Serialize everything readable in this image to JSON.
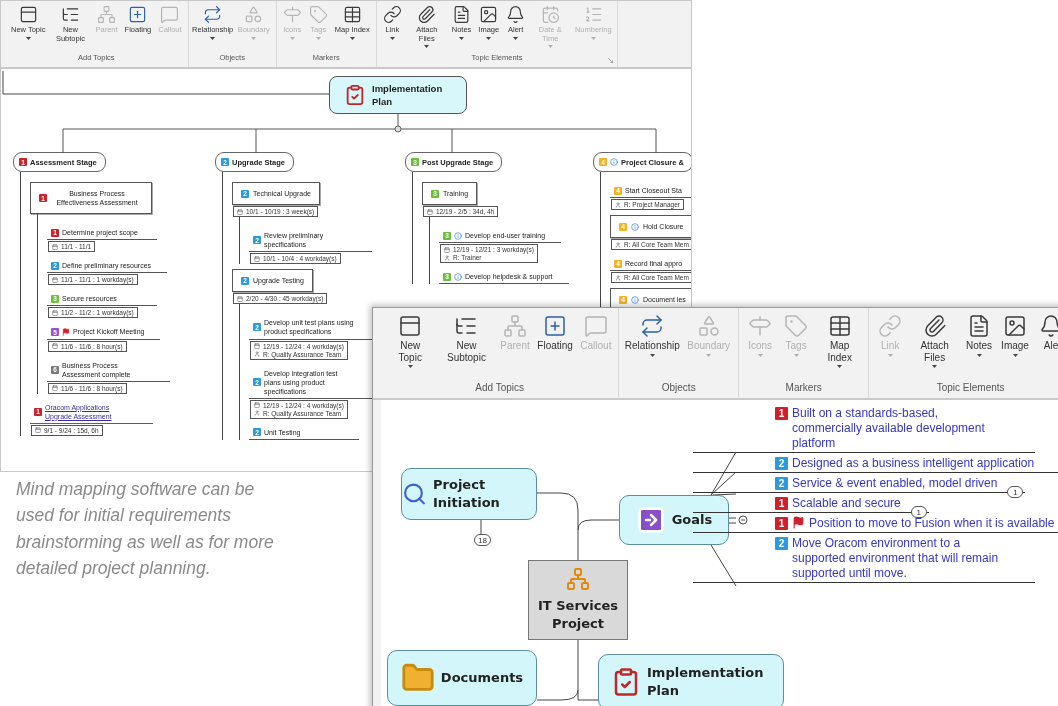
{
  "back_window": {
    "ribbon": {
      "launcher": true,
      "groups": [
        {
          "label": "Add Topics",
          "buttons": [
            {
              "kind": "topic",
              "label": "New Topic",
              "dropdown": true,
              "disabled": false
            },
            {
              "kind": "subtopic",
              "label": "New Subtopic",
              "dropdown": false,
              "disabled": false
            },
            {
              "kind": "parent",
              "label": "Parent",
              "dropdown": false,
              "disabled": true
            },
            {
              "kind": "floating",
              "label": "Floating",
              "dropdown": false,
              "disabled": false
            },
            {
              "kind": "callout",
              "label": "Callout",
              "dropdown": false,
              "disabled": true
            }
          ]
        },
        {
          "label": "Objects",
          "buttons": [
            {
              "kind": "relationship",
              "label": "Relationship",
              "dropdown": true,
              "disabled": false
            },
            {
              "kind": "boundary",
              "label": "Boundary",
              "dropdown": true,
              "disabled": true
            }
          ]
        },
        {
          "label": "Markers",
          "buttons": [
            {
              "kind": "icons",
              "label": "Icons",
              "dropdown": true,
              "disabled": true
            },
            {
              "kind": "tags",
              "label": "Tags",
              "dropdown": true,
              "disabled": true
            },
            {
              "kind": "index",
              "label": "Map Index",
              "dropdown": true,
              "disabled": false
            }
          ]
        },
        {
          "label": "Topic Elements",
          "buttons": [
            {
              "kind": "link",
              "label": "Link",
              "dropdown": true,
              "disabled": false
            },
            {
              "kind": "attach",
              "label": "Attach Files",
              "dropdown": true,
              "disabled": false
            },
            {
              "kind": "notes",
              "label": "Notes",
              "dropdown": true,
              "disabled": false
            },
            {
              "kind": "image",
              "label": "Image",
              "dropdown": true,
              "disabled": false
            },
            {
              "kind": "alert",
              "label": "Alert",
              "dropdown": true,
              "disabled": false
            },
            {
              "kind": "date",
              "label": "Date & Time",
              "dropdown": true,
              "disabled": true
            },
            {
              "kind": "numbering",
              "label": "Numbering",
              "dropdown": true,
              "disabled": true
            }
          ]
        }
      ]
    },
    "map": {
      "central": "Implementation Plan",
      "stages": [
        {
          "label": "Assessment Stage",
          "badge": {
            "text": "1",
            "color": "#d0202a"
          },
          "info": false,
          "children": [
            {
              "kind": "box",
              "label": "Business Process Effectiveness Assessment",
              "badge": {
                "text": "1",
                "color": "#d0202a"
              },
              "flag": false,
              "info": false,
              "hyperlink": false,
              "children": [
                {
                  "kind": "line",
                  "label": "Determine project scope",
                  "badge": {
                    "text": "1",
                    "color": "#d0202a"
                  },
                  "flag": false,
                  "info": false,
                  "hyperlink": false,
                  "details": [
                    {
                      "kind": "date",
                      "text": "11/1 - 11/1"
                    }
                  ]
                },
                {
                  "kind": "line",
                  "label": "Define preliminary resources",
                  "badge": {
                    "text": "2",
                    "color": "#2b9be0"
                  },
                  "flag": false,
                  "info": false,
                  "hyperlink": false,
                  "details": [
                    {
                      "kind": "date",
                      "text": "11/1 - 11/1 : 1 workday(s)"
                    }
                  ]
                },
                {
                  "kind": "line",
                  "label": "Secure resources",
                  "badge": {
                    "text": "3",
                    "color": "#6cbf3a"
                  },
                  "flag": false,
                  "info": false,
                  "hyperlink": false,
                  "details": [
                    {
                      "kind": "date",
                      "text": "11/2 - 11/2 : 1 workday(s)"
                    }
                  ]
                },
                {
                  "kind": "line",
                  "label": "Project Kickoff Meeting",
                  "badge": {
                    "text": "5",
                    "color": "#9b4fd6"
                  },
                  "flag": true,
                  "info": false,
                  "hyperlink": false,
                  "details": [
                    {
                      "kind": "date",
                      "text": "11/6 - 11/6 : 8 hour(s)"
                    }
                  ]
                },
                {
                  "kind": "line",
                  "label": "Business Process Assessment complete",
                  "badge": {
                    "text": "6",
                    "color": "#7a7a7a"
                  },
                  "flag": false,
                  "info": false,
                  "hyperlink": false,
                  "details": [
                    {
                      "kind": "date",
                      "text": "11/6 - 11/6 : 8 hour(s)"
                    }
                  ]
                }
              ]
            },
            {
              "kind": "line",
              "label": "Oracom Applications Upgrade Assessment",
              "badge": {
                "text": "1",
                "color": "#d0202a"
              },
              "flag": false,
              "info": false,
              "hyperlink": true,
              "details": [
                {
                  "kind": "date",
                  "text": "9/1 - 9/24 : 15d, 6h"
                }
              ]
            }
          ]
        },
        {
          "label": "Upgrade Stage",
          "badge": {
            "text": "2",
            "color": "#2b9be0"
          },
          "info": false,
          "children": [
            {
              "kind": "box",
              "label": "Technical Upgrade",
              "badge": {
                "text": "2",
                "color": "#2b9be0"
              },
              "flag": false,
              "info": false,
              "hyperlink": false,
              "details": [
                {
                  "kind": "date",
                  "text": "10/1 - 10/19 : 3 week(s)"
                }
              ],
              "children": [
                {
                  "kind": "line",
                  "label": "Review preliminary specifications",
                  "badge": {
                    "text": "2",
                    "color": "#2b9be0"
                  },
                  "flag": false,
                  "info": false,
                  "hyperlink": false,
                  "details": [
                    {
                      "kind": "date",
                      "text": "10/1 - 10/4 : 4 workday(s)"
                    }
                  ]
                }
              ]
            },
            {
              "kind": "box",
              "label": "Upgrade Testing",
              "badge": {
                "text": "2",
                "color": "#2b9be0"
              },
              "flag": false,
              "info": false,
              "hyperlink": false,
              "details": [
                {
                  "kind": "date",
                  "text": "2/20 - 4/30 : 45 workday(s)"
                }
              ],
              "children": [
                {
                  "kind": "line",
                  "label": "Develop unit test plans using product specifications",
                  "badge": {
                    "text": "2",
                    "color": "#2b9be0"
                  },
                  "flag": false,
                  "info": false,
                  "hyperlink": false,
                  "details": [
                    {
                      "kind": "date",
                      "text": "12/19 - 12/24 : 4 workday(s)"
                    },
                    {
                      "kind": "resource",
                      "text": "R: Quality Assurance Team"
                    }
                  ]
                },
                {
                  "kind": "line",
                  "label": "Develop integration test plans using product specifications",
                  "badge": {
                    "text": "2",
                    "color": "#2b9be0"
                  },
                  "flag": false,
                  "info": false,
                  "hyperlink": false,
                  "details": [
                    {
                      "kind": "date",
                      "text": "12/19 - 12/24 : 4 workday(s)"
                    },
                    {
                      "kind": "resource",
                      "text": "R: Quality Assurance Team"
                    }
                  ]
                },
                {
                  "kind": "line",
                  "label": "Unit Testing",
                  "badge": {
                    "text": "2",
                    "color": "#2b9be0"
                  },
                  "flag": false,
                  "info": false,
                  "hyperlink": false
                }
              ]
            }
          ]
        },
        {
          "label": "Post Upgrade Stage",
          "badge": {
            "text": "3",
            "color": "#6cbf3a"
          },
          "info": false,
          "children": [
            {
              "kind": "box",
              "label": "Training",
              "badge": {
                "text": "3",
                "color": "#6cbf3a"
              },
              "flag": false,
              "info": false,
              "hyperlink": false,
              "details": [
                {
                  "kind": "date",
                  "text": "12/19 - 2/5 : 34d, 4h"
                }
              ],
              "children": [
                {
                  "kind": "line",
                  "label": "Develop end-user training",
                  "badge": {
                    "text": "3",
                    "color": "#6cbf3a"
                  },
                  "flag": false,
                  "info": true,
                  "hyperlink": false,
                  "details": [
                    {
                      "kind": "date",
                      "text": "12/19 - 12/21 : 3 workday(s)"
                    },
                    {
                      "kind": "resource",
                      "text": "R: Trainer"
                    }
                  ]
                },
                {
                  "kind": "line",
                  "label": "Develop helpdesk & support",
                  "badge": {
                    "text": "3",
                    "color": "#6cbf3a"
                  },
                  "flag": false,
                  "info": true,
                  "hyperlink": false
                }
              ]
            }
          ]
        },
        {
          "label": "Project Closure &",
          "badge": {
            "text": "4",
            "color": "#f5b324"
          },
          "info": true,
          "children": [
            {
              "kind": "line",
              "label": "Start Closeout Sta",
              "badge": {
                "text": "4",
                "color": "#f5b324"
              },
              "flag": false,
              "info": false,
              "hyperlink": false,
              "details": [
                {
                  "kind": "resource",
                  "text": "R: Project Manager"
                }
              ]
            },
            {
              "kind": "box",
              "label": "Hold Closure",
              "badge": {
                "text": "4",
                "color": "#f5b324"
              },
              "flag": false,
              "info": true,
              "hyperlink": false,
              "details": [
                {
                  "kind": "resource",
                  "text": "R: All Core Team Mem"
                }
              ]
            },
            {
              "kind": "line",
              "label": "Record final appro",
              "badge": {
                "text": "4",
                "color": "#f5b324"
              },
              "flag": false,
              "info": false,
              "hyperlink": false,
              "details": [
                {
                  "kind": "resource",
                  "text": "R: All Core Team Mem"
                }
              ]
            },
            {
              "kind": "box",
              "label": "Document les",
              "badge": {
                "text": "4",
                "color": "#f5b324"
              },
              "flag": false,
              "info": true,
              "hyperlink": false
            }
          ]
        }
      ]
    }
  },
  "caption": "Mind mapping software can be used for initial requirements brainstorming as well as for more detailed project planning.",
  "front_window": {
    "ribbon": {
      "groups": [
        {
          "label": "Add Topics",
          "buttons": [
            {
              "kind": "topic",
              "label": "New Topic",
              "dropdown": true,
              "disabled": false
            },
            {
              "kind": "subtopic",
              "label": "New Subtopic",
              "dropdown": false,
              "disabled": false
            },
            {
              "kind": "parent",
              "label": "Parent",
              "dropdown": false,
              "disabled": true
            },
            {
              "kind": "floating",
              "label": "Floating",
              "dropdown": false,
              "disabled": false
            },
            {
              "kind": "callout",
              "label": "Callout",
              "dropdown": false,
              "disabled": true
            }
          ]
        },
        {
          "label": "Objects",
          "buttons": [
            {
              "kind": "relationship",
              "label": "Relationship",
              "dropdown": true,
              "disabled": false
            },
            {
              "kind": "boundary",
              "label": "Boundary",
              "dropdown": true,
              "disabled": true
            }
          ]
        },
        {
          "label": "Markers",
          "buttons": [
            {
              "kind": "icons",
              "label": "Icons",
              "dropdown": true,
              "disabled": true
            },
            {
              "kind": "tags",
              "label": "Tags",
              "dropdown": true,
              "disabled": true
            },
            {
              "kind": "index",
              "label": "Map Index",
              "dropdown": true,
              "disabled": false
            }
          ]
        },
        {
          "label": "Topic Elements",
          "buttons": [
            {
              "kind": "link",
              "label": "Link",
              "dropdown": true,
              "disabled": true
            },
            {
              "kind": "attach",
              "label": "Attach Files",
              "dropdown": true,
              "disabled": false
            },
            {
              "kind": "notes",
              "label": "Notes",
              "dropdown": true,
              "disabled": false
            },
            {
              "kind": "image",
              "label": "Image",
              "dropdown": true,
              "disabled": false
            },
            {
              "kind": "alert",
              "label": "Ale",
              "dropdown": false,
              "disabled": false
            }
          ]
        }
      ]
    },
    "map": {
      "central": "IT Services Project",
      "topics": [
        {
          "kind": "initiation",
          "label": "Project Initiation",
          "count": "18"
        },
        {
          "kind": "goals",
          "label": "Goals"
        },
        {
          "kind": "documents",
          "label": "Documents"
        },
        {
          "kind": "plan",
          "label": "Implementation Plan"
        }
      ],
      "goals": [
        {
          "label": "Built on a standards-based, commercially available development platform",
          "badge": {
            "text": "1",
            "color": "#d0202a"
          },
          "flag": false
        },
        {
          "label": "Designed as a business intelligent application",
          "badge": {
            "text": "2",
            "color": "#2b9be0"
          },
          "flag": false
        },
        {
          "label": "Service & event enabled, model driven",
          "badge": {
            "text": "2",
            "color": "#2b9be0"
          },
          "flag": false,
          "count": "1"
        },
        {
          "label": "Scalable and secure",
          "badge": {
            "text": "1",
            "color": "#d0202a"
          },
          "flag": false,
          "count": "1"
        },
        {
          "label": "Position to move to Fusion when it is available",
          "badge": {
            "text": "1",
            "color": "#d0202a"
          },
          "flag": true
        },
        {
          "label": "Move Oracom environment to a supported environment that will remain supported until move.",
          "badge": {
            "text": "2",
            "color": "#2b9be0"
          },
          "flag": false
        }
      ]
    }
  }
}
